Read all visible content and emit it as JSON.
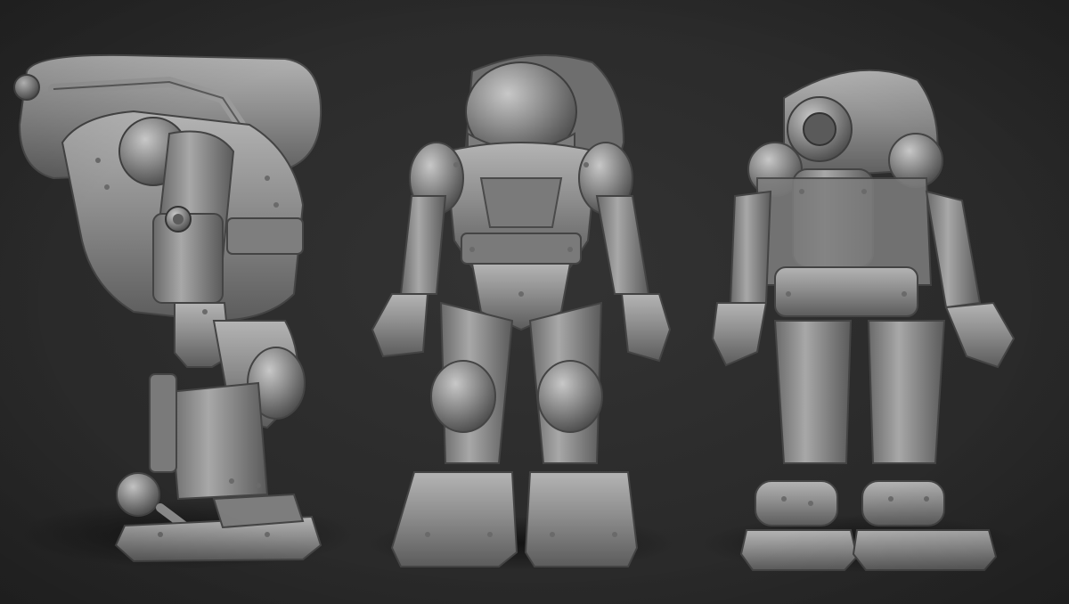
{
  "scene": {
    "background_color": "#2b2b2b",
    "material_color": "#8f8f8f",
    "shadow_color": "#161616",
    "views": [
      {
        "id": "side",
        "label": ""
      },
      {
        "id": "front",
        "label": ""
      },
      {
        "id": "back",
        "label": ""
      }
    ]
  }
}
